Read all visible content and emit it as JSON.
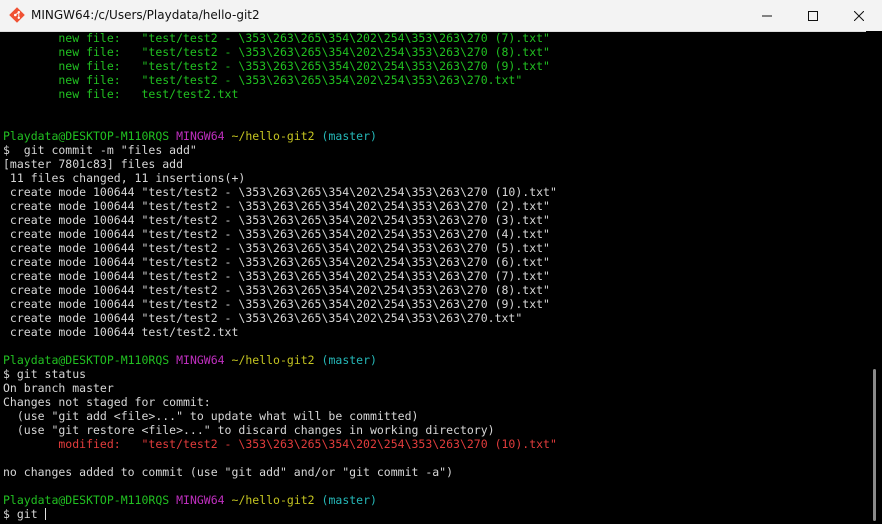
{
  "window": {
    "title": "MINGW64:/c/Users/Playdata/hello-git2",
    "icon": "git-bash-icon"
  },
  "colors": {
    "background": "#000000",
    "text": "#d6d6d6",
    "green": "#21c021",
    "purple": "#bf2fbf",
    "yellow": "#c4c421",
    "cyan": "#25b8b8",
    "red": "#e23c3c"
  },
  "terminal": {
    "lines": [
      [
        {
          "t": "        new file:   \"test/test2 - \\353\\263\\265\\354\\202\\254\\353\\263\\270 (7).txt\"",
          "c": "green"
        }
      ],
      [
        {
          "t": "        new file:   \"test/test2 - \\353\\263\\265\\354\\202\\254\\353\\263\\270 (8).txt\"",
          "c": "green"
        }
      ],
      [
        {
          "t": "        new file:   \"test/test2 - \\353\\263\\265\\354\\202\\254\\353\\263\\270 (9).txt\"",
          "c": "green"
        }
      ],
      [
        {
          "t": "        new file:   \"test/test2 - \\353\\263\\265\\354\\202\\254\\353\\263\\270.txt\"",
          "c": "green"
        }
      ],
      [
        {
          "t": "        new file:   test/test2.txt",
          "c": "green"
        }
      ],
      [],
      [],
      [
        {
          "t": "Playdata@DESKTOP-M110RQS",
          "c": "green"
        },
        {
          "t": " "
        },
        {
          "t": "MINGW64",
          "c": "purple"
        },
        {
          "t": " "
        },
        {
          "t": "~/hello-git2",
          "c": "yellow"
        },
        {
          "t": " "
        },
        {
          "t": "(master)",
          "c": "cyan"
        }
      ],
      [
        {
          "t": "$  git commit -m \"files add\""
        }
      ],
      [
        {
          "t": "[master 7801c83] files add"
        }
      ],
      [
        {
          "t": " 11 files changed, 11 insertions(+)"
        }
      ],
      [
        {
          "t": " create mode 100644 \"test/test2 - \\353\\263\\265\\354\\202\\254\\353\\263\\270 (10).txt\""
        }
      ],
      [
        {
          "t": " create mode 100644 \"test/test2 - \\353\\263\\265\\354\\202\\254\\353\\263\\270 (2).txt\""
        }
      ],
      [
        {
          "t": " create mode 100644 \"test/test2 - \\353\\263\\265\\354\\202\\254\\353\\263\\270 (3).txt\""
        }
      ],
      [
        {
          "t": " create mode 100644 \"test/test2 - \\353\\263\\265\\354\\202\\254\\353\\263\\270 (4).txt\""
        }
      ],
      [
        {
          "t": " create mode 100644 \"test/test2 - \\353\\263\\265\\354\\202\\254\\353\\263\\270 (5).txt\""
        }
      ],
      [
        {
          "t": " create mode 100644 \"test/test2 - \\353\\263\\265\\354\\202\\254\\353\\263\\270 (6).txt\""
        }
      ],
      [
        {
          "t": " create mode 100644 \"test/test2 - \\353\\263\\265\\354\\202\\254\\353\\263\\270 (7).txt\""
        }
      ],
      [
        {
          "t": " create mode 100644 \"test/test2 - \\353\\263\\265\\354\\202\\254\\353\\263\\270 (8).txt\""
        }
      ],
      [
        {
          "t": " create mode 100644 \"test/test2 - \\353\\263\\265\\354\\202\\254\\353\\263\\270 (9).txt\""
        }
      ],
      [
        {
          "t": " create mode 100644 \"test/test2 - \\353\\263\\265\\354\\202\\254\\353\\263\\270.txt\""
        }
      ],
      [
        {
          "t": " create mode 100644 test/test2.txt"
        }
      ],
      [],
      [
        {
          "t": "Playdata@DESKTOP-M110RQS",
          "c": "green"
        },
        {
          "t": " "
        },
        {
          "t": "MINGW64",
          "c": "purple"
        },
        {
          "t": " "
        },
        {
          "t": "~/hello-git2",
          "c": "yellow"
        },
        {
          "t": " "
        },
        {
          "t": "(master)",
          "c": "cyan"
        }
      ],
      [
        {
          "t": "$ git status"
        }
      ],
      [
        {
          "t": "On branch master"
        }
      ],
      [
        {
          "t": "Changes not staged for commit:"
        }
      ],
      [
        {
          "t": "  (use \"git add <file>...\" to update what will be committed)"
        }
      ],
      [
        {
          "t": "  (use \"git restore <file>...\" to discard changes in working directory)"
        }
      ],
      [
        {
          "t": "        modified:   \"test/test2 - \\353\\263\\265\\354\\202\\254\\353\\263\\270 (10).txt\"",
          "c": "red"
        }
      ],
      [],
      [
        {
          "t": "no changes added to commit (use \"git add\" and/or \"git commit -a\")"
        }
      ],
      [],
      [
        {
          "t": "Playdata@DESKTOP-M110RQS",
          "c": "green"
        },
        {
          "t": " "
        },
        {
          "t": "MINGW64",
          "c": "purple"
        },
        {
          "t": " "
        },
        {
          "t": "~/hello-git2",
          "c": "yellow"
        },
        {
          "t": " "
        },
        {
          "t": "(master)",
          "c": "cyan"
        }
      ]
    ],
    "input_line": {
      "prompt": "$ ",
      "value": "git "
    }
  }
}
